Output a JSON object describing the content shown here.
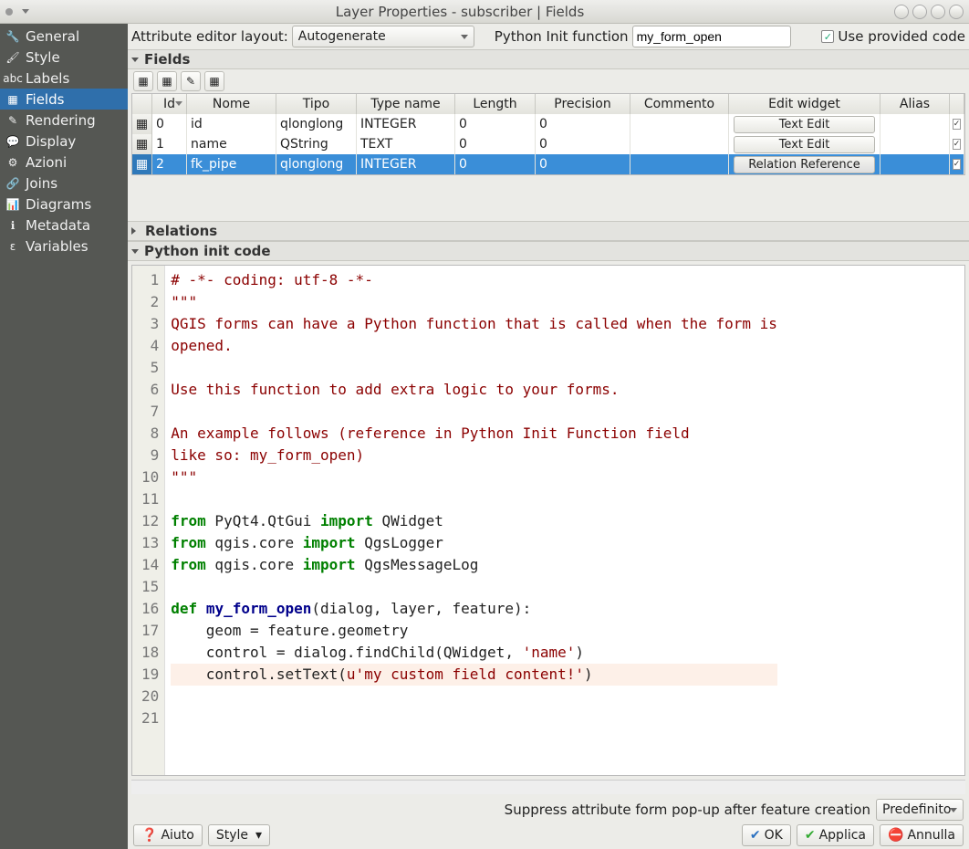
{
  "window": {
    "title": "Layer Properties - subscriber | Fields"
  },
  "sidebar": {
    "items": [
      {
        "label": "General",
        "icon": "🔧"
      },
      {
        "label": "Style",
        "icon": "🖌"
      },
      {
        "label": "Labels",
        "icon": "abc"
      },
      {
        "label": "Fields",
        "icon": "▦"
      },
      {
        "label": "Rendering",
        "icon": "✎"
      },
      {
        "label": "Display",
        "icon": "💬"
      },
      {
        "label": "Azioni",
        "icon": "⚙"
      },
      {
        "label": "Joins",
        "icon": "🔗"
      },
      {
        "label": "Diagrams",
        "icon": "📊"
      },
      {
        "label": "Metadata",
        "icon": "ℹ"
      },
      {
        "label": "Variables",
        "icon": "ε"
      }
    ],
    "selected_index": 3
  },
  "top": {
    "attr_editor_label": "Attribute editor layout:",
    "attr_editor_value": "Autogenerate",
    "py_init_label": "Python Init function",
    "py_init_value": "my_form_open",
    "use_provided_label": "Use provided code",
    "use_provided_checked": true
  },
  "sections": {
    "fields": "Fields",
    "relations": "Relations",
    "python": "Python init code"
  },
  "table": {
    "headers": [
      "Id",
      "Nome",
      "Tipo",
      "Type name",
      "Length",
      "Precision",
      "Commento",
      "Edit widget",
      "Alias"
    ],
    "rows": [
      {
        "id": "0",
        "nome": "id",
        "tipo": "qlonglong",
        "typename": "INTEGER",
        "length": "0",
        "precision": "0",
        "commento": "",
        "widget": "Text Edit",
        "alias": "",
        "checked": true,
        "selected": false
      },
      {
        "id": "1",
        "nome": "name",
        "tipo": "QString",
        "typename": "TEXT",
        "length": "0",
        "precision": "0",
        "commento": "",
        "widget": "Text Edit",
        "alias": "",
        "checked": true,
        "selected": false
      },
      {
        "id": "2",
        "nome": "fk_pipe",
        "tipo": "qlonglong",
        "typename": "INTEGER",
        "length": "0",
        "precision": "0",
        "commento": "",
        "widget": "Relation Reference",
        "alias": "",
        "checked": true,
        "selected": true
      }
    ]
  },
  "code": {
    "lines": [
      {
        "n": 1,
        "segs": [
          {
            "t": "# -*- coding: utf-8 -*-",
            "c": "c-com"
          }
        ]
      },
      {
        "n": 2,
        "segs": [
          {
            "t": "\"\"\"",
            "c": "c-str"
          }
        ]
      },
      {
        "n": 3,
        "segs": [
          {
            "t": "QGIS forms can have a Python function that is called when the form is",
            "c": "c-str"
          }
        ]
      },
      {
        "n": 4,
        "segs": [
          {
            "t": "opened.",
            "c": "c-str"
          }
        ]
      },
      {
        "n": 5,
        "segs": [
          {
            "t": " ",
            "c": ""
          }
        ]
      },
      {
        "n": 6,
        "segs": [
          {
            "t": "Use this function to add extra logic to your forms.",
            "c": "c-str"
          }
        ]
      },
      {
        "n": 7,
        "segs": [
          {
            "t": " ",
            "c": ""
          }
        ]
      },
      {
        "n": 8,
        "segs": [
          {
            "t": "An example follows (reference in Python Init Function field",
            "c": "c-str"
          }
        ]
      },
      {
        "n": 9,
        "segs": [
          {
            "t": "like so: my_form_open)",
            "c": "c-str"
          }
        ]
      },
      {
        "n": 10,
        "segs": [
          {
            "t": "\"\"\"",
            "c": "c-str"
          }
        ]
      },
      {
        "n": 11,
        "segs": [
          {
            "t": " ",
            "c": ""
          }
        ]
      },
      {
        "n": 12,
        "segs": [
          {
            "t": "from",
            "c": "c-key"
          },
          {
            "t": " PyQt4.QtGui ",
            "c": ""
          },
          {
            "t": "import",
            "c": "c-key"
          },
          {
            "t": " QWidget",
            "c": ""
          }
        ]
      },
      {
        "n": 13,
        "segs": [
          {
            "t": "from",
            "c": "c-key"
          },
          {
            "t": " qgis.core ",
            "c": ""
          },
          {
            "t": "import",
            "c": "c-key"
          },
          {
            "t": " QgsLogger",
            "c": ""
          }
        ]
      },
      {
        "n": 14,
        "segs": [
          {
            "t": "from",
            "c": "c-key"
          },
          {
            "t": " qgis.core ",
            "c": ""
          },
          {
            "t": "import",
            "c": "c-key"
          },
          {
            "t": " QgsMessageLog",
            "c": ""
          }
        ]
      },
      {
        "n": 15,
        "segs": [
          {
            "t": " ",
            "c": ""
          }
        ]
      },
      {
        "n": 16,
        "segs": [
          {
            "t": "def",
            "c": "c-key"
          },
          {
            "t": " ",
            "c": ""
          },
          {
            "t": "my_form_open",
            "c": "c-def"
          },
          {
            "t": "(dialog, layer, feature):",
            "c": ""
          }
        ]
      },
      {
        "n": 17,
        "segs": [
          {
            "t": "    geom = feature.geometry",
            "c": ""
          }
        ]
      },
      {
        "n": 18,
        "segs": [
          {
            "t": "    control = dialog.findChild(QWidget, ",
            "c": ""
          },
          {
            "t": "'name'",
            "c": "c-lit"
          },
          {
            "t": ")",
            "c": ""
          }
        ]
      },
      {
        "n": 19,
        "hl": true,
        "segs": [
          {
            "t": "    control.setText(",
            "c": ""
          },
          {
            "t": "u'my custom field content!'",
            "c": "c-lit"
          },
          {
            "t": ")",
            "c": ""
          }
        ]
      },
      {
        "n": 20,
        "segs": [
          {
            "t": " ",
            "c": ""
          }
        ]
      },
      {
        "n": 21,
        "segs": [
          {
            "t": " ",
            "c": ""
          }
        ]
      }
    ]
  },
  "footer": {
    "suppress_label": "Suppress attribute form pop-up after feature creation",
    "suppress_value": "Predefinito",
    "help": "Aiuto",
    "style": "Style",
    "ok": "OK",
    "apply": "Applica",
    "cancel": "Annulla"
  }
}
